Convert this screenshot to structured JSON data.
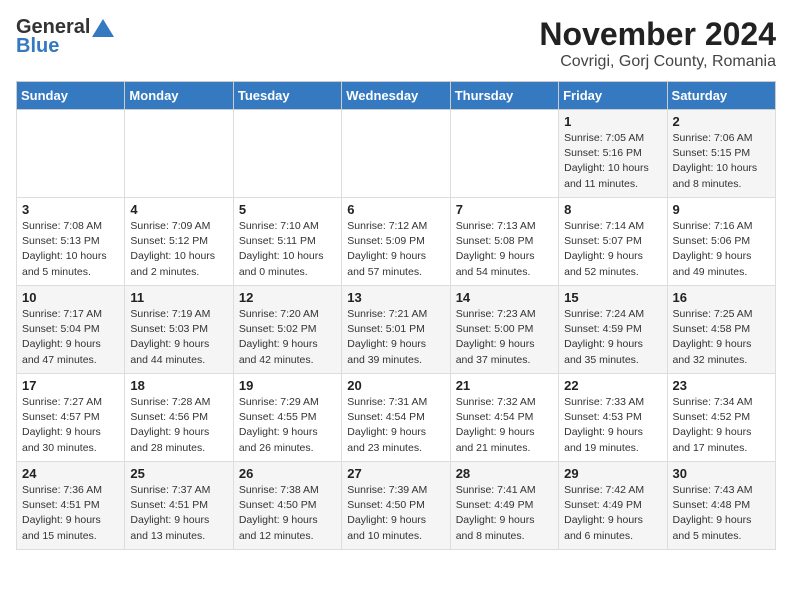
{
  "logo": {
    "general": "General",
    "blue": "Blue"
  },
  "header": {
    "month": "November 2024",
    "location": "Covrigi, Gorj County, Romania"
  },
  "weekdays": [
    "Sunday",
    "Monday",
    "Tuesday",
    "Wednesday",
    "Thursday",
    "Friday",
    "Saturday"
  ],
  "weeks": [
    [
      {
        "day": "",
        "info": ""
      },
      {
        "day": "",
        "info": ""
      },
      {
        "day": "",
        "info": ""
      },
      {
        "day": "",
        "info": ""
      },
      {
        "day": "",
        "info": ""
      },
      {
        "day": "1",
        "info": "Sunrise: 7:05 AM\nSunset: 5:16 PM\nDaylight: 10 hours and 11 minutes."
      },
      {
        "day": "2",
        "info": "Sunrise: 7:06 AM\nSunset: 5:15 PM\nDaylight: 10 hours and 8 minutes."
      }
    ],
    [
      {
        "day": "3",
        "info": "Sunrise: 7:08 AM\nSunset: 5:13 PM\nDaylight: 10 hours and 5 minutes."
      },
      {
        "day": "4",
        "info": "Sunrise: 7:09 AM\nSunset: 5:12 PM\nDaylight: 10 hours and 2 minutes."
      },
      {
        "day": "5",
        "info": "Sunrise: 7:10 AM\nSunset: 5:11 PM\nDaylight: 10 hours and 0 minutes."
      },
      {
        "day": "6",
        "info": "Sunrise: 7:12 AM\nSunset: 5:09 PM\nDaylight: 9 hours and 57 minutes."
      },
      {
        "day": "7",
        "info": "Sunrise: 7:13 AM\nSunset: 5:08 PM\nDaylight: 9 hours and 54 minutes."
      },
      {
        "day": "8",
        "info": "Sunrise: 7:14 AM\nSunset: 5:07 PM\nDaylight: 9 hours and 52 minutes."
      },
      {
        "day": "9",
        "info": "Sunrise: 7:16 AM\nSunset: 5:06 PM\nDaylight: 9 hours and 49 minutes."
      }
    ],
    [
      {
        "day": "10",
        "info": "Sunrise: 7:17 AM\nSunset: 5:04 PM\nDaylight: 9 hours and 47 minutes."
      },
      {
        "day": "11",
        "info": "Sunrise: 7:19 AM\nSunset: 5:03 PM\nDaylight: 9 hours and 44 minutes."
      },
      {
        "day": "12",
        "info": "Sunrise: 7:20 AM\nSunset: 5:02 PM\nDaylight: 9 hours and 42 minutes."
      },
      {
        "day": "13",
        "info": "Sunrise: 7:21 AM\nSunset: 5:01 PM\nDaylight: 9 hours and 39 minutes."
      },
      {
        "day": "14",
        "info": "Sunrise: 7:23 AM\nSunset: 5:00 PM\nDaylight: 9 hours and 37 minutes."
      },
      {
        "day": "15",
        "info": "Sunrise: 7:24 AM\nSunset: 4:59 PM\nDaylight: 9 hours and 35 minutes."
      },
      {
        "day": "16",
        "info": "Sunrise: 7:25 AM\nSunset: 4:58 PM\nDaylight: 9 hours and 32 minutes."
      }
    ],
    [
      {
        "day": "17",
        "info": "Sunrise: 7:27 AM\nSunset: 4:57 PM\nDaylight: 9 hours and 30 minutes."
      },
      {
        "day": "18",
        "info": "Sunrise: 7:28 AM\nSunset: 4:56 PM\nDaylight: 9 hours and 28 minutes."
      },
      {
        "day": "19",
        "info": "Sunrise: 7:29 AM\nSunset: 4:55 PM\nDaylight: 9 hours and 26 minutes."
      },
      {
        "day": "20",
        "info": "Sunrise: 7:31 AM\nSunset: 4:54 PM\nDaylight: 9 hours and 23 minutes."
      },
      {
        "day": "21",
        "info": "Sunrise: 7:32 AM\nSunset: 4:54 PM\nDaylight: 9 hours and 21 minutes."
      },
      {
        "day": "22",
        "info": "Sunrise: 7:33 AM\nSunset: 4:53 PM\nDaylight: 9 hours and 19 minutes."
      },
      {
        "day": "23",
        "info": "Sunrise: 7:34 AM\nSunset: 4:52 PM\nDaylight: 9 hours and 17 minutes."
      }
    ],
    [
      {
        "day": "24",
        "info": "Sunrise: 7:36 AM\nSunset: 4:51 PM\nDaylight: 9 hours and 15 minutes."
      },
      {
        "day": "25",
        "info": "Sunrise: 7:37 AM\nSunset: 4:51 PM\nDaylight: 9 hours and 13 minutes."
      },
      {
        "day": "26",
        "info": "Sunrise: 7:38 AM\nSunset: 4:50 PM\nDaylight: 9 hours and 12 minutes."
      },
      {
        "day": "27",
        "info": "Sunrise: 7:39 AM\nSunset: 4:50 PM\nDaylight: 9 hours and 10 minutes."
      },
      {
        "day": "28",
        "info": "Sunrise: 7:41 AM\nSunset: 4:49 PM\nDaylight: 9 hours and 8 minutes."
      },
      {
        "day": "29",
        "info": "Sunrise: 7:42 AM\nSunset: 4:49 PM\nDaylight: 9 hours and 6 minutes."
      },
      {
        "day": "30",
        "info": "Sunrise: 7:43 AM\nSunset: 4:48 PM\nDaylight: 9 hours and 5 minutes."
      }
    ]
  ]
}
